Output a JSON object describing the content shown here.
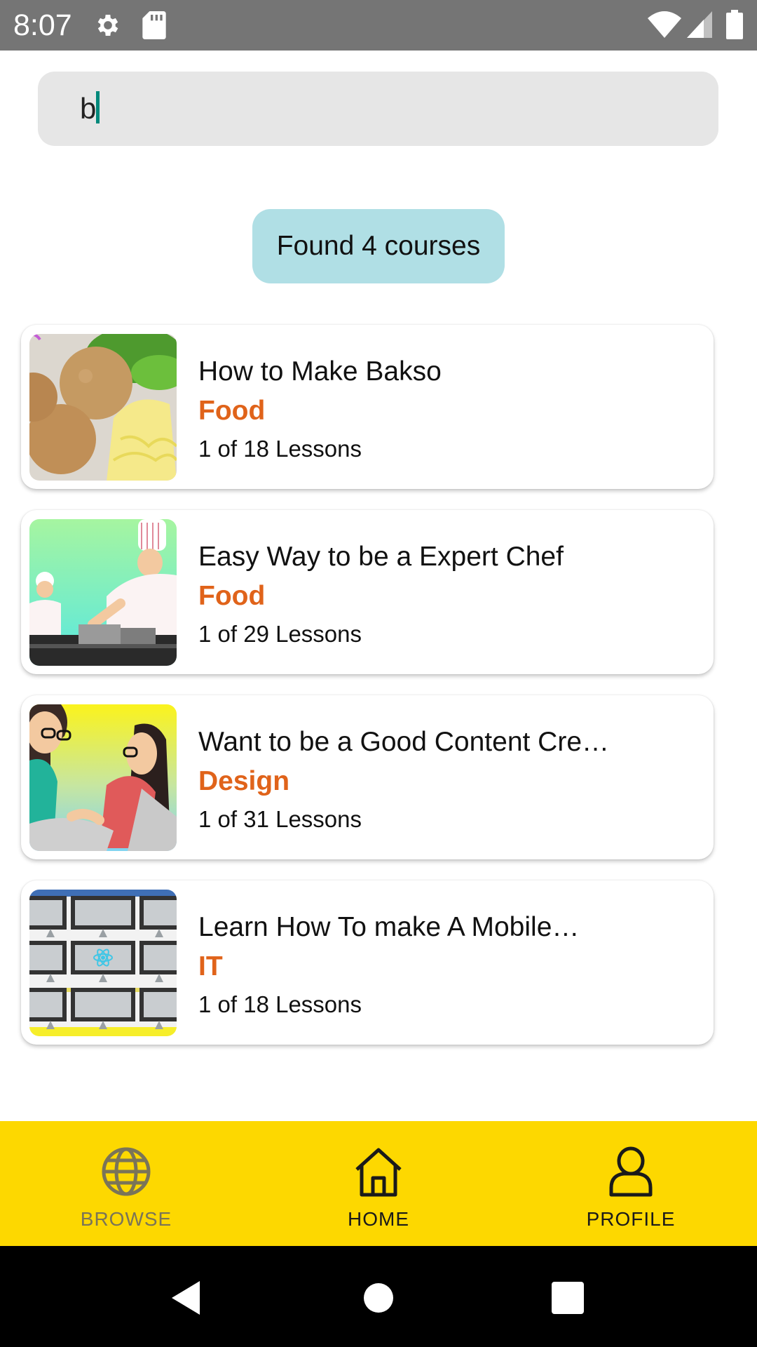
{
  "status_bar": {
    "time": "8:07",
    "icons": [
      "settings-icon",
      "sdcard-icon",
      "wifi-icon",
      "signal-icon",
      "battery-icon"
    ],
    "background": "#757575"
  },
  "search": {
    "value": "b",
    "placeholder": ""
  },
  "result": {
    "text": "Found 4 courses",
    "background": "#b0dfe5"
  },
  "courses": [
    {
      "title": "How to Make Bakso",
      "category": "Food",
      "lessons": "1 of 18 Lessons",
      "thumbnail": "bakso-image"
    },
    {
      "title": "Easy Way to be a Expert Chef",
      "category": "Food",
      "lessons": "1 of 29 Lessons",
      "thumbnail": "chef-image"
    },
    {
      "title": "Want to be a Good Content Cre…",
      "category": "Design",
      "lessons": "1 of 31 Lessons",
      "thumbnail": "content-creator-image"
    },
    {
      "title": "Learn How To make A Mobile…",
      "category": "IT",
      "lessons": "1 of 18 Lessons",
      "thumbnail": "mobile-app-image"
    }
  ],
  "tabs": [
    {
      "label": "BROWSE",
      "icon": "globe-icon",
      "active": false
    },
    {
      "label": "HOME",
      "icon": "home-icon",
      "active": true
    },
    {
      "label": "PROFILE",
      "icon": "user-icon",
      "active": false
    }
  ],
  "nav": {
    "icons": [
      "back-icon",
      "home-circle-icon",
      "recents-icon"
    ]
  },
  "colors": {
    "accent_category": "#e0631a",
    "tab_bar": "#fdd800",
    "caret": "#00897b"
  }
}
